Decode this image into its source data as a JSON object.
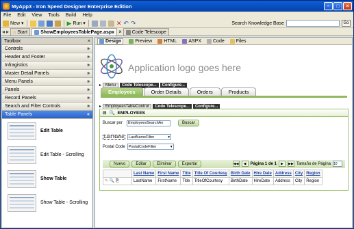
{
  "window": {
    "title": "MyApp3 - Iron Speed Designer Enterprise Edition"
  },
  "menu": [
    "File",
    "Edit",
    "View",
    "Tools",
    "Build",
    "Help"
  ],
  "toolbar": {
    "new_label": "New",
    "run_label": "Run",
    "kb_label": "Search Knowledge Base",
    "go_label": "Go"
  },
  "doc_tabs": {
    "start": "Start",
    "page": "ShowEmployeesTablePage.aspx",
    "telescope": "Code Telescope"
  },
  "toolbox": {
    "title": "Toolbox",
    "categories": [
      "Controls",
      "Header and Footer",
      "Infragistics",
      "Master Detail Panels",
      "Menu Panels",
      "Panels",
      "Record Panels",
      "Search and Filter Controls",
      "Table Panels"
    ],
    "items": [
      "Edit Table",
      "Edit Table - Scrolling",
      "Show Table",
      "Show Table - Scrolling"
    ]
  },
  "view_tabs": [
    "Design",
    "Preview",
    "HTML",
    "ASPX",
    "Code",
    "Files"
  ],
  "designer": {
    "logo_text": "Application logo goes here",
    "menu_bar": {
      "label": "Menu",
      "telescope": "Code Telescope...",
      "configure": "Configure..."
    },
    "tabs": [
      "Employees",
      "Order Details",
      "Orders",
      "Products"
    ],
    "table_bar": {
      "label": "EmployeesTableControl",
      "telescope": "Code Telescope...",
      "configure": "Configure..."
    },
    "panel_title": "EMPLOYEES",
    "search_label": "Buscar por",
    "search_value": "EmployeesSearchAn",
    "search_button": "Buscar",
    "lastname_label": "Last Name",
    "lastname_filter": "LastNameFilter",
    "postal_label": "Postal Code",
    "postal_filter": "PostalCodeFilter",
    "actions": [
      "Nuevo",
      "Editar",
      "Eliminar",
      "Exportar"
    ],
    "pager": {
      "page_text": "Página 1 de 1",
      "size_label": "Tamaño de Página",
      "size_value": "10"
    },
    "columns": [
      "Last Name",
      "First Name",
      "Title",
      "Title Of Courtesy",
      "Birth Date",
      "Hire Date",
      "Address",
      "City",
      "Region"
    ],
    "row": [
      "LastName",
      "FirstName",
      "Title",
      "TitleOfCourtesy",
      "BirthDate",
      "HireDate",
      "Address",
      "City",
      "Region"
    ]
  }
}
